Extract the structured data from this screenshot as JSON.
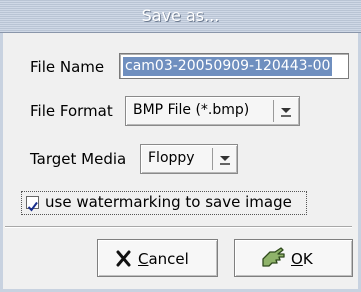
{
  "window": {
    "title": "Save as..."
  },
  "form": {
    "file_name": {
      "label": "File Name",
      "value": "cam03-20050909-120443-00"
    },
    "file_format": {
      "label": "File Format",
      "selected": "BMP File (*.bmp)"
    },
    "target_media": {
      "label": "Target Media",
      "selected": "Floppy"
    },
    "watermark": {
      "label": "use watermarking to save image",
      "checked": true
    }
  },
  "buttons": {
    "cancel": {
      "label_accel": "C",
      "label_rest": "ancel",
      "icon": "x-cross-icon"
    },
    "ok": {
      "label_accel": "O",
      "label_rest": "K",
      "icon": "hand-pointer-icon"
    }
  },
  "colors": {
    "selection": "#6f8fbf",
    "accent": "#c8d2e0"
  }
}
